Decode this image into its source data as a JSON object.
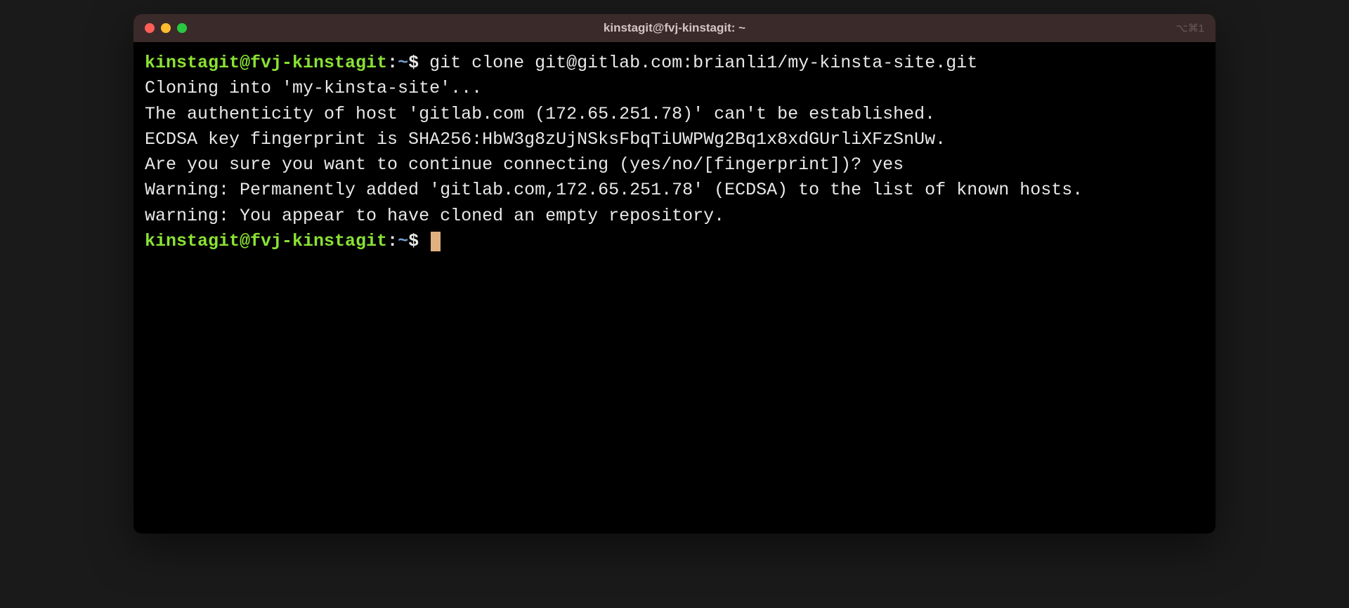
{
  "titleBar": {
    "title": "kinstagit@fvj-kinstagit: ~",
    "shortcut": "⌥⌘1"
  },
  "prompt": {
    "userHost": "kinstagit@fvj-kinstagit",
    "separator": ":",
    "path": "~",
    "symbol": "$"
  },
  "command1": "git clone git@gitlab.com:brianli1/my-kinsta-site.git",
  "output": {
    "line1": "Cloning into 'my-kinsta-site'...",
    "line2": "The authenticity of host 'gitlab.com (172.65.251.78)' can't be established.",
    "line3": "ECDSA key fingerprint is SHA256:HbW3g8zUjNSksFbqTiUWPWg2Bq1x8xdGUrliXFzSnUw.",
    "line4": "Are you sure you want to continue connecting (yes/no/[fingerprint])? yes",
    "line5": "Warning: Permanently added 'gitlab.com,172.65.251.78' (ECDSA) to the list of known hosts.",
    "line6": "warning: You appear to have cloned an empty repository."
  }
}
